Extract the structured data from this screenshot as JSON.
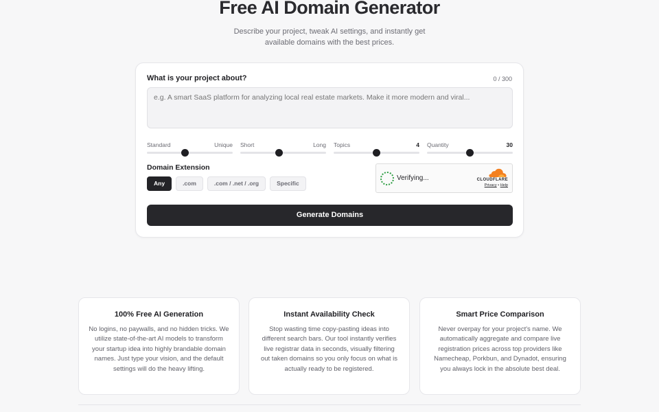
{
  "hero": {
    "title": "Free AI Domain Generator",
    "subtitle": "Describe your project, tweak AI settings, and instantly get available domains with the best prices."
  },
  "form": {
    "question_label": "What is your project about?",
    "char_count": "0 / 300",
    "placeholder": "e.g. A smart SaaS platform for analyzing local real estate markets. Make it more modern and viral...",
    "sliders": [
      {
        "left": "Standard",
        "right": "Unique",
        "value": 0.44
      },
      {
        "left": "Short",
        "right": "Long",
        "value": 0.45
      },
      {
        "left": "Topics",
        "right": "4",
        "value": 0.5
      },
      {
        "left": "Quantity",
        "right": "30",
        "value": 0.5
      }
    ],
    "extension_label": "Domain Extension",
    "extensions": [
      "Any",
      ".com",
      ".com / .net / .org",
      "Specific"
    ],
    "selected_extension": "Any",
    "generate_label": "Generate Domains"
  },
  "captcha": {
    "status": "Verifying...",
    "brand": "CLOUDFLARE",
    "privacy": "Privacy",
    "separator": "•",
    "help": "Help",
    "brand_color": "#f38020",
    "spinner_color": "#2f9e44"
  },
  "features": [
    {
      "title": "100% Free AI Generation",
      "body": "No logins, no paywalls, and no hidden tricks. We utilize state-of-the-art AI models to transform your startup idea into highly brandable domain names. Just type your vision, and the default settings will do the heavy lifting."
    },
    {
      "title": "Instant Availability Check",
      "body": "Stop wasting time copy-pasting ideas into different search bars. Our tool instantly verifies live registrar data in seconds, visually filtering out taken domains so you only focus on what is actually ready to be registered."
    },
    {
      "title": "Smart Price Comparison",
      "body": "Never overpay for your project's name. We automatically aggregate and compare live registration prices across top providers like Namecheap, Porkbun, and Dynadot, ensuring you always lock in the absolute best deal."
    }
  ],
  "colors": {
    "page_bg": "#f7f7f8",
    "primary_dark": "#27272b",
    "muted_text": "#6b6b73"
  }
}
